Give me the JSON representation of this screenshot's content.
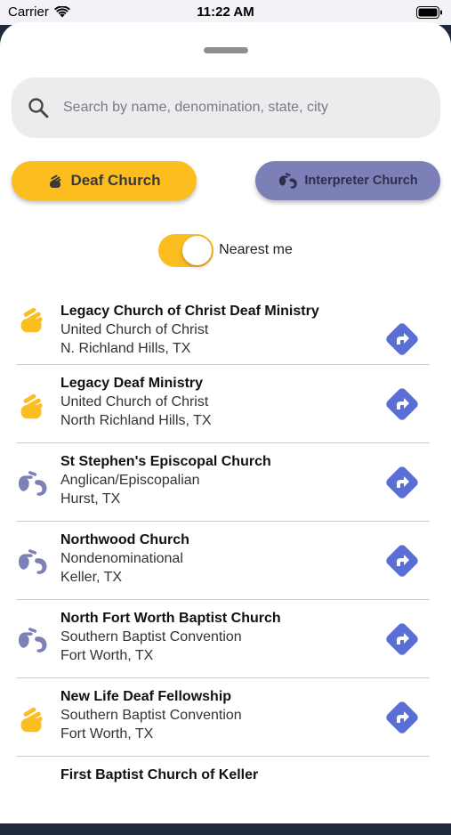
{
  "status_bar": {
    "carrier": "Carrier",
    "time": "11:22 AM"
  },
  "search": {
    "placeholder": "Search by name, denomination, state, city",
    "value": ""
  },
  "filters": {
    "deaf_label": "Deaf Church",
    "interpreter_label": "Interpreter Church"
  },
  "nearest": {
    "label": "Nearest me",
    "on": true
  },
  "colors": {
    "deaf": "#fbbd1f",
    "interpreter": "#7c80b6",
    "direction": "#5a6fd6"
  },
  "churches": [
    {
      "name": "Legacy Church of Christ Deaf Ministry",
      "denomination": "United Church of Christ",
      "location": "N. Richland Hills, TX",
      "type": "deaf"
    },
    {
      "name": "Legacy Deaf Ministry",
      "denomination": "United Church of Christ",
      "location": "North Richland Hills, TX",
      "type": "deaf"
    },
    {
      "name": "St Stephen's Episcopal Church",
      "denomination": "Anglican/Episcopalian",
      "location": "Hurst, TX",
      "type": "interpreter"
    },
    {
      "name": "Northwood Church",
      "denomination": "Nondenominational",
      "location": "Keller, TX",
      "type": "interpreter"
    },
    {
      "name": "North Fort Worth Baptist Church",
      "denomination": "Southern Baptist Convention",
      "location": "Fort Worth, TX",
      "type": "interpreter"
    },
    {
      "name": "New Life Deaf Fellowship",
      "denomination": "Southern Baptist Convention",
      "location": "Fort Worth, TX",
      "type": "deaf"
    },
    {
      "name": "First Baptist Church of Keller",
      "denomination": "",
      "location": "",
      "type": "interpreter"
    }
  ]
}
